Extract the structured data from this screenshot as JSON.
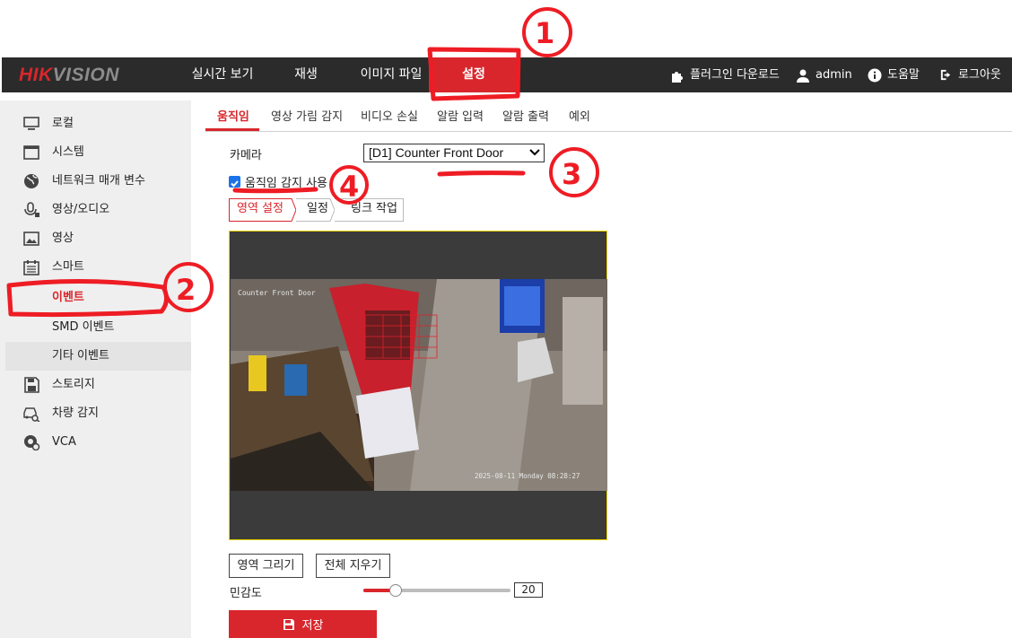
{
  "brand": {
    "hik": "HIK",
    "vision": "VISION"
  },
  "topnav": [
    {
      "label": "실시간 보기"
    },
    {
      "label": "재생"
    },
    {
      "label": "이미지 파일"
    },
    {
      "label": "설정"
    }
  ],
  "topright": {
    "plugin": "플러그인 다운로드",
    "user": "admin",
    "help": "도움말",
    "logout": "로그아웃"
  },
  "sidebar": [
    {
      "label": "로컬",
      "icon": "monitor-icon"
    },
    {
      "label": "시스템",
      "icon": "window-icon"
    },
    {
      "label": "네트워크 매개 변수",
      "icon": "globe-icon"
    },
    {
      "label": "영상/오디오",
      "icon": "camera-mic-icon"
    },
    {
      "label": "영상",
      "icon": "image-icon"
    },
    {
      "label": "스마트",
      "icon": "calendar-icon"
    },
    {
      "label": "이벤트"
    },
    {
      "label": "SMD 이벤트"
    },
    {
      "label": "기타 이벤트"
    },
    {
      "label": "스토리지",
      "icon": "floppy-icon"
    },
    {
      "label": "차량 감지",
      "icon": "car-search-icon"
    },
    {
      "label": "VCA",
      "icon": "vca-icon"
    }
  ],
  "tabs": [
    {
      "label": "움직임"
    },
    {
      "label": "영상 가림 감지"
    },
    {
      "label": "비디오 손실"
    },
    {
      "label": "알람 입력"
    },
    {
      "label": "알람 출력"
    },
    {
      "label": "예외"
    }
  ],
  "camera": {
    "label": "카메라",
    "value": "[D1] Counter Front Door"
  },
  "enable_motion": {
    "label": "움직임 감지 사용",
    "checked": true
  },
  "steps": [
    {
      "label": "영역 설정"
    },
    {
      "label": "일정"
    },
    {
      "label": "링크 작업"
    }
  ],
  "video": {
    "osd_name": "Counter Front Door",
    "osd_time": "2025-08-11 Monday 08:28:27"
  },
  "buttons": {
    "draw_area": "영역 그리기",
    "clear_all": "전체 지우기",
    "save": "저장"
  },
  "sensitivity": {
    "label": "민감도",
    "value": "20",
    "fraction": 0.22
  },
  "annotations": [
    "1",
    "2",
    "3",
    "4"
  ],
  "colors": {
    "accent": "#d9262c",
    "topbar": "#2b2b2b",
    "annotation": "#ee1c24",
    "video_border": "#e6d200"
  }
}
